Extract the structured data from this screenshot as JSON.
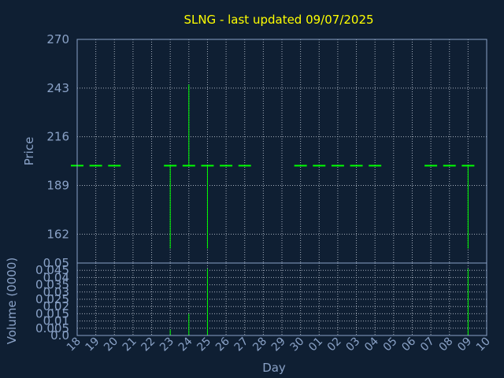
{
  "chart_data": {
    "type": "candlestick",
    "title": "SLNG - last updated 09/07/2025",
    "xlabel": "Day",
    "colors": {
      "background": "#0f1f33",
      "title": "#ffff00",
      "axis_text": "#8aa2c7",
      "series": "#00ff00"
    },
    "x_ticks": [
      "18",
      "19",
      "20",
      "21",
      "22",
      "23",
      "24",
      "25",
      "26",
      "27",
      "28",
      "29",
      "30",
      "01",
      "02",
      "03",
      "04",
      "05",
      "06",
      "07",
      "08",
      "09",
      "10"
    ],
    "price_panel": {
      "ylabel": "Price",
      "ylim": [
        146,
        270
      ],
      "y_ticks": [
        "270",
        "243",
        "216",
        "189",
        "162"
      ],
      "y_tick_values": [
        270,
        243,
        216,
        189,
        162
      ],
      "grid": true,
      "bars": [
        {
          "day": 0,
          "open": 200,
          "high": 200,
          "low": 200,
          "close": 200
        },
        {
          "day": 1,
          "open": 200,
          "high": 200,
          "low": 200,
          "close": 200
        },
        {
          "day": 2,
          "open": 200,
          "high": 200,
          "low": 200,
          "close": 200
        },
        {
          "day": 5,
          "open": 200,
          "high": 200,
          "low": 154,
          "close": 200
        },
        {
          "day": 6,
          "open": 200,
          "high": 245,
          "low": 200,
          "close": 200
        },
        {
          "day": 7,
          "open": 200,
          "high": 200,
          "low": 154,
          "close": 200
        },
        {
          "day": 8,
          "open": 200,
          "high": 200,
          "low": 200,
          "close": 200
        },
        {
          "day": 9,
          "open": 200,
          "high": 200,
          "low": 200,
          "close": 200
        },
        {
          "day": 12,
          "open": 200,
          "high": 200,
          "low": 200,
          "close": 200
        },
        {
          "day": 13,
          "open": 200,
          "high": 200,
          "low": 200,
          "close": 200
        },
        {
          "day": 14,
          "open": 200,
          "high": 200,
          "low": 200,
          "close": 200
        },
        {
          "day": 15,
          "open": 200,
          "high": 200,
          "low": 200,
          "close": 200
        },
        {
          "day": 16,
          "open": 200,
          "high": 200,
          "low": 200,
          "close": 200
        },
        {
          "day": 19,
          "open": 200,
          "high": 200,
          "low": 200,
          "close": 200
        },
        {
          "day": 20,
          "open": 200,
          "high": 200,
          "low": 200,
          "close": 200
        },
        {
          "day": 21,
          "open": 200,
          "high": 200,
          "low": 154,
          "close": 200
        }
      ]
    },
    "volume_panel": {
      "ylabel": "Volume (0000)",
      "ylim": [
        0,
        0.05
      ],
      "y_ticks": [
        "0.05",
        "0.045",
        "0.04",
        "0.035",
        "0.03",
        "0.025",
        "0.02",
        "0.015",
        "0.01",
        "0.005",
        "0.0"
      ],
      "y_tick_values": [
        0.05,
        0.045,
        0.04,
        0.035,
        0.03,
        0.025,
        0.02,
        0.015,
        0.01,
        0.005,
        0.0
      ],
      "grid": true,
      "bars": [
        {
          "day": 5,
          "volume": 0.004
        },
        {
          "day": 6,
          "volume": 0.015
        },
        {
          "day": 7,
          "volume": 0.046
        },
        {
          "day": 21,
          "volume": 0.046
        }
      ]
    }
  }
}
